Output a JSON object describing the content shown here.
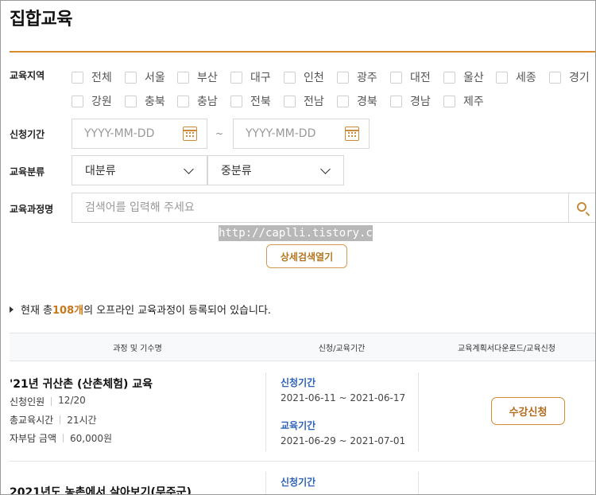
{
  "page": {
    "title": "집합교육",
    "accent_color": "#d98a2b",
    "link_color": "#2b62b8"
  },
  "filters": {
    "region_label": "교육지역",
    "regions_row1": [
      "전체",
      "서울",
      "부산",
      "대구",
      "인천",
      "광주",
      "대전",
      "울산",
      "세종",
      "경기"
    ],
    "regions_row2": [
      "강원",
      "충북",
      "충남",
      "전북",
      "전남",
      "경북",
      "경남",
      "제주"
    ],
    "period_label": "신청기간",
    "date_start_placeholder": "YYYY-MM-DD",
    "date_end_placeholder": "YYYY-MM-DD",
    "date_separator": "~",
    "category_label": "교육분류",
    "category_major": "대분류",
    "category_minor": "중분류",
    "course_name_label": "교육과정명",
    "search_placeholder": "검색어를 입력해 주세요",
    "advanced_button": "상세검색열기"
  },
  "watermark": "http://caplli.tistory.com",
  "summary": {
    "prefix": "현재 총 ",
    "count": "108개",
    "suffix": "의 오프라인 교육과정이 등록되어 있습니다."
  },
  "table": {
    "headers": [
      "과정 및 기수명",
      "신청/교육기간",
      "교육계획서다운로드/교육신청"
    ],
    "rows": [
      {
        "title": "'21년 귀산촌 (산촌체험) 교육",
        "applicants_label": "신청인원",
        "applicants": "12/20",
        "hours_label": "총교육시간",
        "hours": "21시간",
        "fee_label": "자부담 금액",
        "fee": "60,000원",
        "apply_label": "신청기간",
        "apply_period": "2021-06-11 ~ 2021-06-17",
        "edu_label": "교육기간",
        "edu_period": "2021-06-29 ~ 2021-07-01",
        "button": "수강신청"
      },
      {
        "title": "2021년도 농촌에서 살아보기(무주군)",
        "apply_label": "신청기간"
      }
    ]
  }
}
